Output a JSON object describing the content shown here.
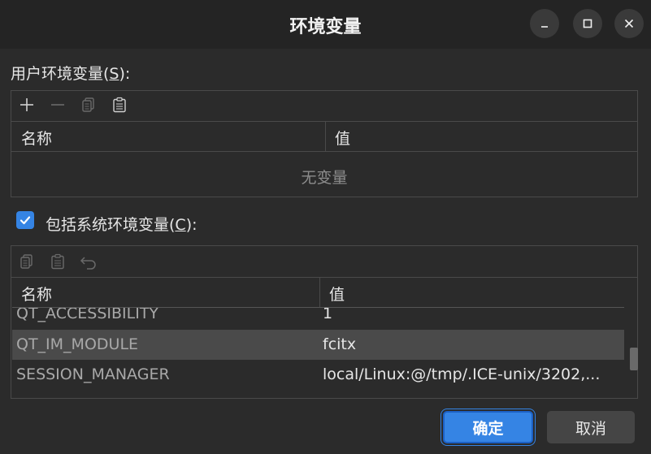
{
  "window": {
    "title": "环境变量"
  },
  "user_section": {
    "label_prefix": "用户环境变量(",
    "label_mnemonic": "S",
    "label_suffix": "):",
    "columns": [
      "名称",
      "值"
    ],
    "empty_text": "无变量"
  },
  "system_section": {
    "include_label_prefix": "包括系统环境变量(",
    "include_label_mnemonic": "C",
    "include_label_suffix": "):",
    "include_checked": true,
    "columns": [
      "名称",
      "值"
    ],
    "rows": [
      {
        "name": "QT_ACCESSIBILITY",
        "value": "1",
        "selected": false
      },
      {
        "name": "QT_IM_MODULE",
        "value": "fcitx",
        "selected": true
      },
      {
        "name": "SESSION_MANAGER",
        "value": "local/Linux:@/tmp/.ICE-unix/3202,...",
        "selected": false
      }
    ]
  },
  "buttons": {
    "ok": "确定",
    "cancel": "取消"
  },
  "colors": {
    "accent": "#3584e4",
    "background": "#2b2b2b",
    "selection": "#4a4a4a"
  }
}
